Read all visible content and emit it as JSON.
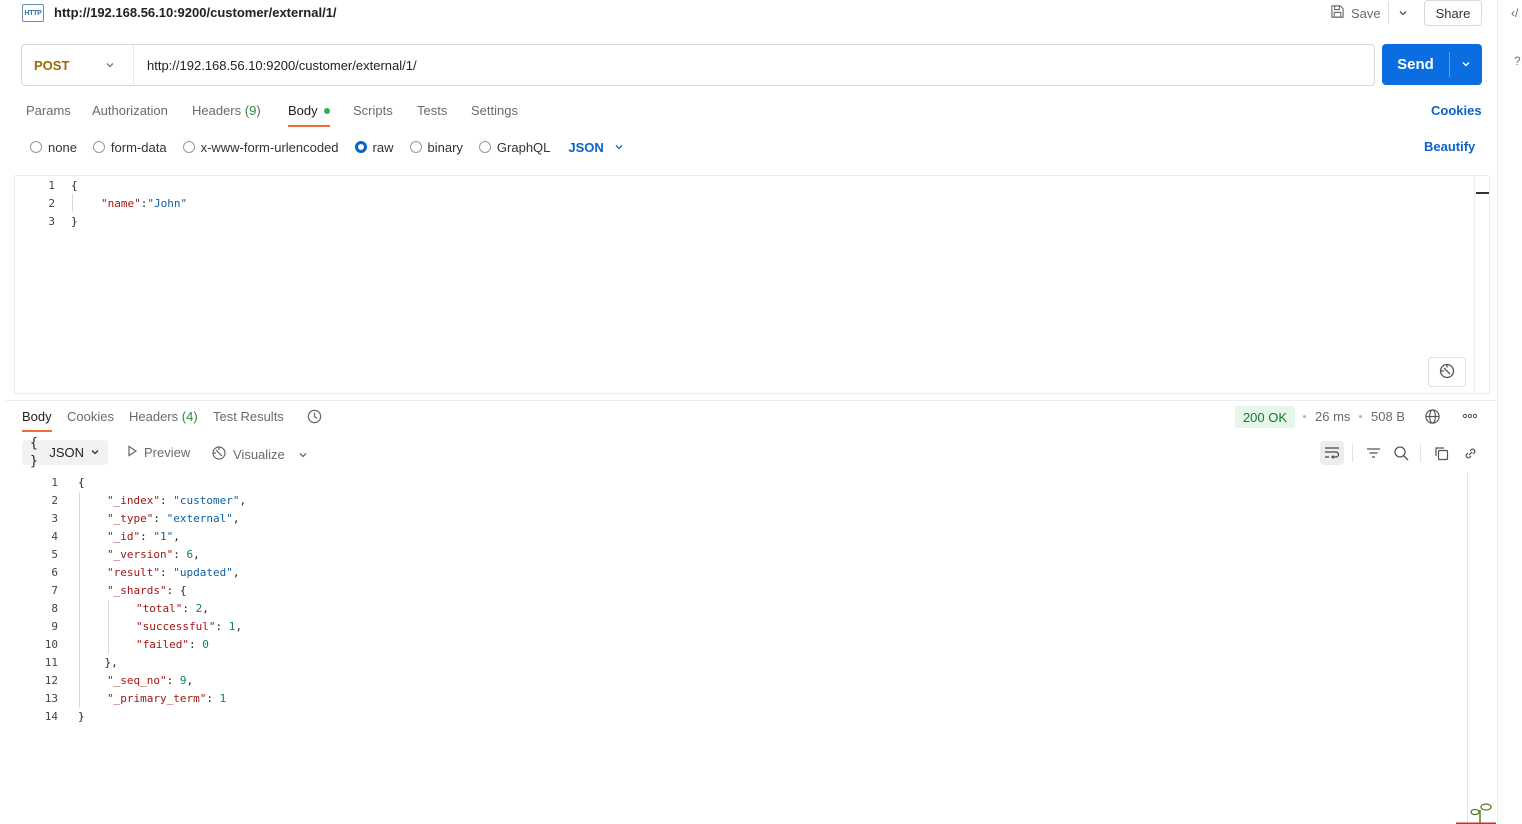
{
  "request": {
    "title": "http://192.168.56.10:9200/customer/external/1/",
    "http_badge": "HTTP",
    "method": "POST",
    "url": "http://192.168.56.10:9200/customer/external/1/",
    "save_label": "Save",
    "share_label": "Share",
    "send_label": "Send",
    "tabs": {
      "params": "Params",
      "authorization": "Authorization",
      "headers": "Headers",
      "headers_count": "(9)",
      "body": "Body",
      "scripts": "Scripts",
      "tests": "Tests",
      "settings": "Settings"
    },
    "cookies_link": "Cookies",
    "beautify_link": "Beautify",
    "body_types": {
      "none": "none",
      "form_data": "form-data",
      "urlencoded": "x-www-form-urlencoded",
      "raw": "raw",
      "binary": "binary",
      "graphql": "GraphQL"
    },
    "selected_body_type": "raw",
    "format": "JSON",
    "body_lines": [
      {
        "n": "1",
        "t": "{"
      },
      {
        "n": "2",
        "key": "\"name\"",
        "sep": ":",
        "val": "\"John\""
      },
      {
        "n": "3",
        "t": "}"
      }
    ]
  },
  "response": {
    "tabs": {
      "body": "Body",
      "cookies": "Cookies",
      "headers": "Headers",
      "headers_count": "(4)",
      "test_results": "Test Results"
    },
    "status": "200 OK",
    "time": "26 ms",
    "size": "508 B",
    "format": "JSON",
    "format_glyph": "{ }",
    "preview_label": "Preview",
    "visualize_label": "Visualize",
    "body_lines": [
      {
        "n": "1",
        "t": "{"
      },
      {
        "n": "2",
        "key": "\"_index\"",
        "val": "\"customer\"",
        "type": "s",
        "end": ","
      },
      {
        "n": "3",
        "key": "\"_type\"",
        "val": "\"external\"",
        "type": "s",
        "end": ","
      },
      {
        "n": "4",
        "key": "\"_id\"",
        "val": "\"1\"",
        "type": "s",
        "end": ","
      },
      {
        "n": "5",
        "key": "\"_version\"",
        "val": "6",
        "type": "n",
        "end": ","
      },
      {
        "n": "6",
        "key": "\"result\"",
        "val": "\"updated\"",
        "type": "s",
        "end": ","
      },
      {
        "n": "7",
        "key": "\"_shards\"",
        "val": "{",
        "type": "p",
        "end": ""
      },
      {
        "n": "8",
        "key": "\"total\"",
        "val": "2",
        "type": "n",
        "end": ",",
        "indent": 2
      },
      {
        "n": "9",
        "key": "\"successful\"",
        "val": "1",
        "type": "n",
        "end": ",",
        "indent": 2
      },
      {
        "n": "10",
        "key": "\"failed\"",
        "val": "0",
        "type": "n",
        "end": "",
        "indent": 2
      },
      {
        "n": "11",
        "t": "    },"
      },
      {
        "n": "12",
        "key": "\"_seq_no\"",
        "val": "9",
        "type": "n",
        "end": ","
      },
      {
        "n": "13",
        "key": "\"_primary_term\"",
        "val": "1",
        "type": "n",
        "end": ""
      },
      {
        "n": "14",
        "t": "}"
      }
    ]
  },
  "colors": {
    "accent": "#0b6ee0",
    "tab_underline": "#f26b3a",
    "status_ok_bg": "#e6f6ea",
    "status_ok_text": "#14792f",
    "method_post": "#a06a00"
  }
}
